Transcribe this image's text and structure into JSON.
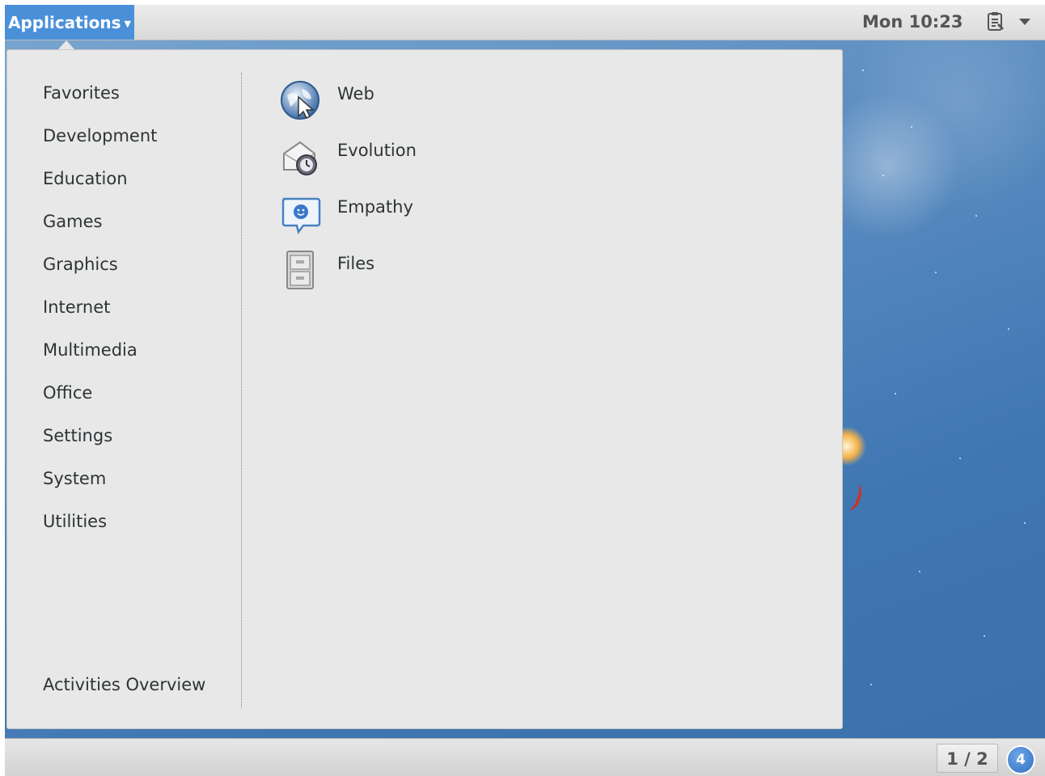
{
  "topbar": {
    "applications_label": "Applications",
    "clock": "Mon 10:23",
    "tray_icon": "clipboard-icon",
    "system_menu_icon": "chevron-down-icon"
  },
  "menu": {
    "categories": [
      {
        "label": "Favorites"
      },
      {
        "label": "Development"
      },
      {
        "label": "Education"
      },
      {
        "label": "Games"
      },
      {
        "label": "Graphics"
      },
      {
        "label": "Internet"
      },
      {
        "label": "Multimedia"
      },
      {
        "label": "Office"
      },
      {
        "label": "Settings"
      },
      {
        "label": "System"
      },
      {
        "label": "Utilities"
      }
    ],
    "activities_label": "Activities Overview",
    "apps": [
      {
        "label": "Web",
        "icon": "web-browser-icon"
      },
      {
        "label": "Evolution",
        "icon": "evolution-mail-icon"
      },
      {
        "label": "Empathy",
        "icon": "empathy-chat-icon"
      },
      {
        "label": "Files",
        "icon": "file-cabinet-icon"
      }
    ]
  },
  "bottombar": {
    "workspace_indicator": "1 / 2",
    "notification_count": "4"
  },
  "colors": {
    "accent": "#4a90d9",
    "menu_bg": "#e8e8e8",
    "text": "#2e3436"
  }
}
